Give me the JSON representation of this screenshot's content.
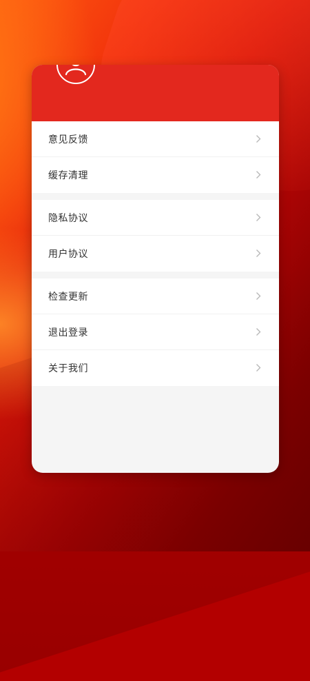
{
  "menu": {
    "groups": [
      {
        "items": [
          {
            "label": "意见反馈"
          },
          {
            "label": "缓存清理"
          }
        ]
      },
      {
        "items": [
          {
            "label": "隐私协议"
          },
          {
            "label": "用户协议"
          }
        ]
      },
      {
        "items": [
          {
            "label": "检查更新"
          },
          {
            "label": "退出登录"
          },
          {
            "label": "关于我们"
          }
        ]
      }
    ]
  },
  "colors": {
    "header": "#e3281e",
    "card_bg": "#f5f5f5",
    "row_bg": "#ffffff",
    "text": "#333333",
    "chevron": "#b8b8b8"
  },
  "icons": {
    "avatar": "user-avatar-icon",
    "chevron": "chevron-right-icon"
  }
}
